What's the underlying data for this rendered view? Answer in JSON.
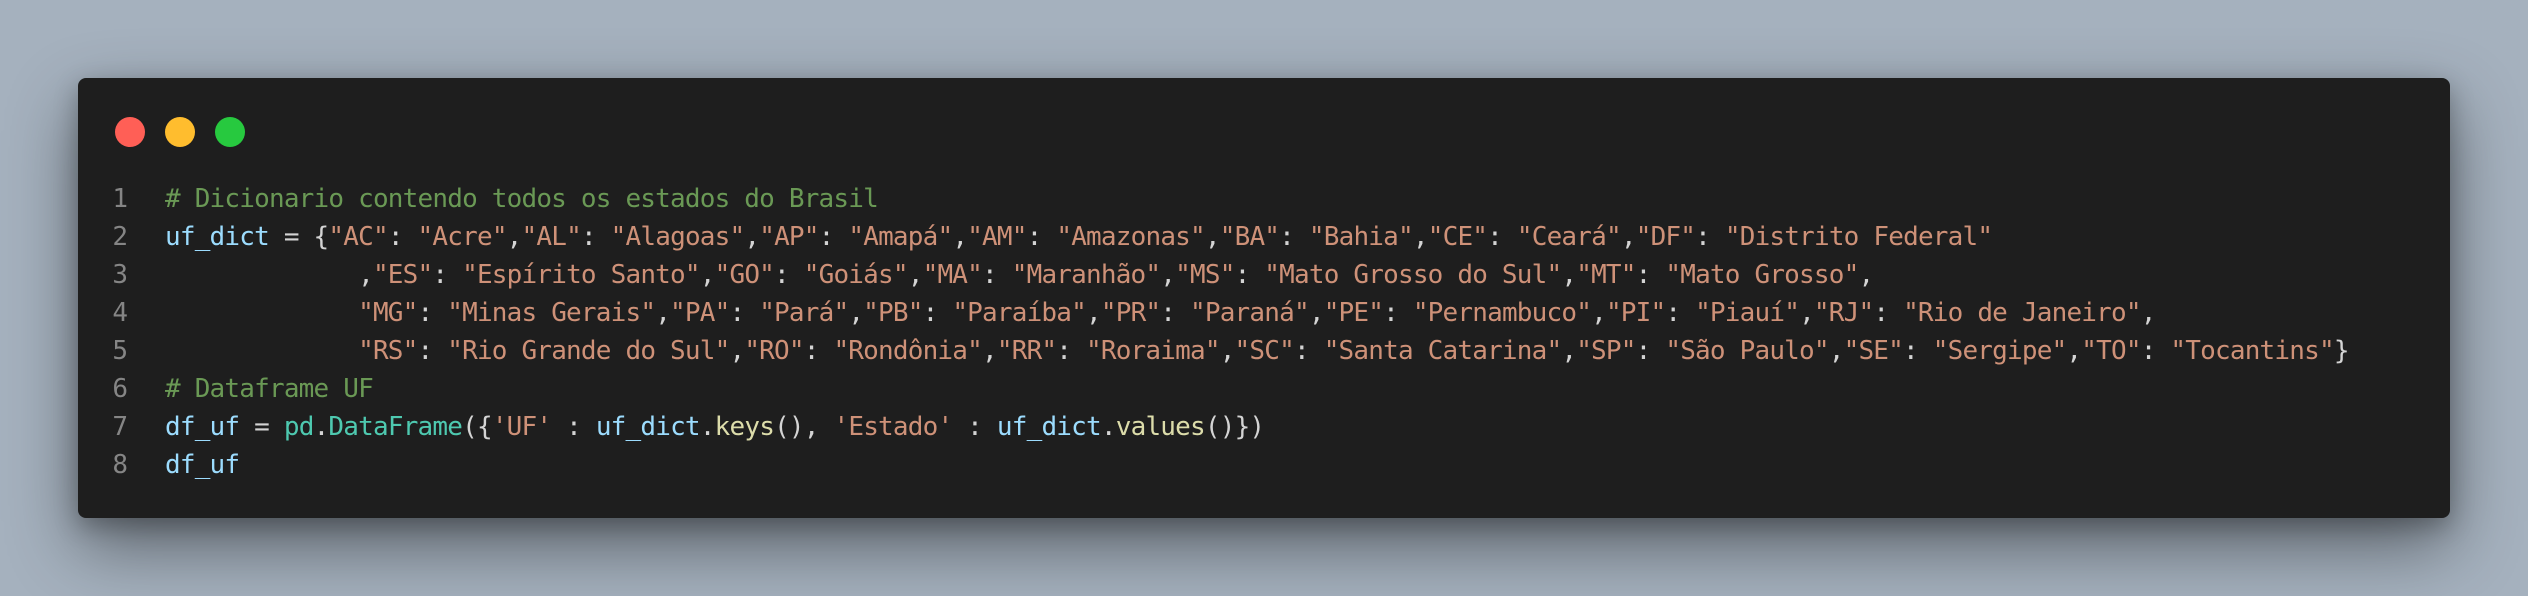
{
  "window": {
    "controls": {
      "close_color": "#ff5f56",
      "minimize_color": "#ffbd2e",
      "maximize_color": "#27c93f"
    }
  },
  "code": {
    "lines": [
      {
        "number": "1",
        "tokens": [
          {
            "t": "comment",
            "v": "# Dicionario contendo todos os estados do Brasil"
          }
        ]
      },
      {
        "number": "2",
        "tokens": [
          {
            "t": "var",
            "v": "uf_dict"
          },
          {
            "t": "op",
            "v": " = {"
          },
          {
            "t": "str",
            "v": "\"AC\""
          },
          {
            "t": "op",
            "v": ": "
          },
          {
            "t": "str",
            "v": "\"Acre\""
          },
          {
            "t": "op",
            "v": ","
          },
          {
            "t": "str",
            "v": "\"AL\""
          },
          {
            "t": "op",
            "v": ": "
          },
          {
            "t": "str",
            "v": "\"Alagoas\""
          },
          {
            "t": "op",
            "v": ","
          },
          {
            "t": "str",
            "v": "\"AP\""
          },
          {
            "t": "op",
            "v": ": "
          },
          {
            "t": "str",
            "v": "\"Amapá\""
          },
          {
            "t": "op",
            "v": ","
          },
          {
            "t": "str",
            "v": "\"AM\""
          },
          {
            "t": "op",
            "v": ": "
          },
          {
            "t": "str",
            "v": "\"Amazonas\""
          },
          {
            "t": "op",
            "v": ","
          },
          {
            "t": "str",
            "v": "\"BA\""
          },
          {
            "t": "op",
            "v": ": "
          },
          {
            "t": "str",
            "v": "\"Bahia\""
          },
          {
            "t": "op",
            "v": ","
          },
          {
            "t": "str",
            "v": "\"CE\""
          },
          {
            "t": "op",
            "v": ": "
          },
          {
            "t": "str",
            "v": "\"Ceará\""
          },
          {
            "t": "op",
            "v": ","
          },
          {
            "t": "str",
            "v": "\"DF\""
          },
          {
            "t": "op",
            "v": ": "
          },
          {
            "t": "str",
            "v": "\"Distrito Federal\""
          }
        ]
      },
      {
        "number": "3",
        "tokens": [
          {
            "t": "op",
            "v": "             ,"
          },
          {
            "t": "str",
            "v": "\"ES\""
          },
          {
            "t": "op",
            "v": ": "
          },
          {
            "t": "str",
            "v": "\"Espírito Santo\""
          },
          {
            "t": "op",
            "v": ","
          },
          {
            "t": "str",
            "v": "\"GO\""
          },
          {
            "t": "op",
            "v": ": "
          },
          {
            "t": "str",
            "v": "\"Goiás\""
          },
          {
            "t": "op",
            "v": ","
          },
          {
            "t": "str",
            "v": "\"MA\""
          },
          {
            "t": "op",
            "v": ": "
          },
          {
            "t": "str",
            "v": "\"Maranhão\""
          },
          {
            "t": "op",
            "v": ","
          },
          {
            "t": "str",
            "v": "\"MS\""
          },
          {
            "t": "op",
            "v": ": "
          },
          {
            "t": "str",
            "v": "\"Mato Grosso do Sul\""
          },
          {
            "t": "op",
            "v": ","
          },
          {
            "t": "str",
            "v": "\"MT\""
          },
          {
            "t": "op",
            "v": ": "
          },
          {
            "t": "str",
            "v": "\"Mato Grosso\""
          },
          {
            "t": "op",
            "v": ","
          }
        ]
      },
      {
        "number": "4",
        "tokens": [
          {
            "t": "op",
            "v": "             "
          },
          {
            "t": "str",
            "v": "\"MG\""
          },
          {
            "t": "op",
            "v": ": "
          },
          {
            "t": "str",
            "v": "\"Minas Gerais\""
          },
          {
            "t": "op",
            "v": ","
          },
          {
            "t": "str",
            "v": "\"PA\""
          },
          {
            "t": "op",
            "v": ": "
          },
          {
            "t": "str",
            "v": "\"Pará\""
          },
          {
            "t": "op",
            "v": ","
          },
          {
            "t": "str",
            "v": "\"PB\""
          },
          {
            "t": "op",
            "v": ": "
          },
          {
            "t": "str",
            "v": "\"Paraíba\""
          },
          {
            "t": "op",
            "v": ","
          },
          {
            "t": "str",
            "v": "\"PR\""
          },
          {
            "t": "op",
            "v": ": "
          },
          {
            "t": "str",
            "v": "\"Paraná\""
          },
          {
            "t": "op",
            "v": ","
          },
          {
            "t": "str",
            "v": "\"PE\""
          },
          {
            "t": "op",
            "v": ": "
          },
          {
            "t": "str",
            "v": "\"Pernambuco\""
          },
          {
            "t": "op",
            "v": ","
          },
          {
            "t": "str",
            "v": "\"PI\""
          },
          {
            "t": "op",
            "v": ": "
          },
          {
            "t": "str",
            "v": "\"Piauí\""
          },
          {
            "t": "op",
            "v": ","
          },
          {
            "t": "str",
            "v": "\"RJ\""
          },
          {
            "t": "op",
            "v": ": "
          },
          {
            "t": "str",
            "v": "\"Rio de Janeiro\""
          },
          {
            "t": "op",
            "v": ","
          }
        ]
      },
      {
        "number": "5",
        "tokens": [
          {
            "t": "op",
            "v": "             "
          },
          {
            "t": "str",
            "v": "\"RS\""
          },
          {
            "t": "op",
            "v": ": "
          },
          {
            "t": "str",
            "v": "\"Rio Grande do Sul\""
          },
          {
            "t": "op",
            "v": ","
          },
          {
            "t": "str",
            "v": "\"RO\""
          },
          {
            "t": "op",
            "v": ": "
          },
          {
            "t": "str",
            "v": "\"Rondônia\""
          },
          {
            "t": "op",
            "v": ","
          },
          {
            "t": "str",
            "v": "\"RR\""
          },
          {
            "t": "op",
            "v": ": "
          },
          {
            "t": "str",
            "v": "\"Roraima\""
          },
          {
            "t": "op",
            "v": ","
          },
          {
            "t": "str",
            "v": "\"SC\""
          },
          {
            "t": "op",
            "v": ": "
          },
          {
            "t": "str",
            "v": "\"Santa Catarina\""
          },
          {
            "t": "op",
            "v": ","
          },
          {
            "t": "str",
            "v": "\"SP\""
          },
          {
            "t": "op",
            "v": ": "
          },
          {
            "t": "str",
            "v": "\"São Paulo\""
          },
          {
            "t": "op",
            "v": ","
          },
          {
            "t": "str",
            "v": "\"SE\""
          },
          {
            "t": "op",
            "v": ": "
          },
          {
            "t": "str",
            "v": "\"Sergipe\""
          },
          {
            "t": "op",
            "v": ","
          },
          {
            "t": "str",
            "v": "\"TO\""
          },
          {
            "t": "op",
            "v": ": "
          },
          {
            "t": "str",
            "v": "\"Tocantins\""
          },
          {
            "t": "op",
            "v": "}"
          }
        ]
      },
      {
        "number": "6",
        "tokens": [
          {
            "t": "comment",
            "v": "# Dataframe UF"
          }
        ]
      },
      {
        "number": "7",
        "tokens": [
          {
            "t": "var",
            "v": "df_uf"
          },
          {
            "t": "op",
            "v": " = "
          },
          {
            "t": "mod",
            "v": "pd"
          },
          {
            "t": "op",
            "v": "."
          },
          {
            "t": "mod",
            "v": "DataFrame"
          },
          {
            "t": "op",
            "v": "({"
          },
          {
            "t": "str",
            "v": "'UF'"
          },
          {
            "t": "op",
            "v": " : "
          },
          {
            "t": "var",
            "v": "uf_dict"
          },
          {
            "t": "op",
            "v": "."
          },
          {
            "t": "fn",
            "v": "keys"
          },
          {
            "t": "op",
            "v": "(), "
          },
          {
            "t": "str",
            "v": "'Estado'"
          },
          {
            "t": "op",
            "v": " : "
          },
          {
            "t": "var",
            "v": "uf_dict"
          },
          {
            "t": "op",
            "v": "."
          },
          {
            "t": "fn",
            "v": "values"
          },
          {
            "t": "op",
            "v": "()})"
          }
        ]
      },
      {
        "number": "8",
        "tokens": [
          {
            "t": "var",
            "v": "df_uf"
          }
        ]
      }
    ]
  }
}
